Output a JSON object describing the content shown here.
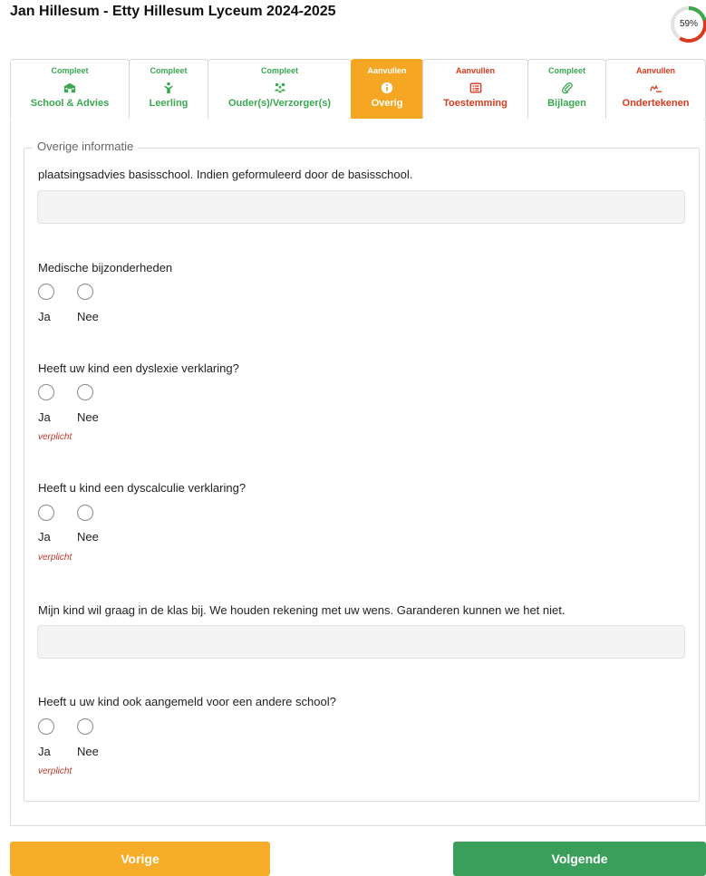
{
  "header": {
    "title": "Jan Hillesum - Etty Hillesum Lyceum 2024-2025",
    "progress_label": "59%",
    "progress_value": 59
  },
  "tabs": [
    {
      "status": "Compleet",
      "label": "School & Advies",
      "icon": "school-icon"
    },
    {
      "status": "Compleet",
      "label": "Leerling",
      "icon": "student-icon"
    },
    {
      "status": "Compleet",
      "label": "Ouder(s)/Verzorger(s)",
      "icon": "parents-icon"
    },
    {
      "status": "Aanvullen",
      "label": "Overig",
      "icon": "info-icon"
    },
    {
      "status": "Aanvullen",
      "label": "Toestemming",
      "icon": "list-icon"
    },
    {
      "status": "Compleet",
      "label": "Bijlagen",
      "icon": "paperclip-icon"
    },
    {
      "status": "Aanvullen",
      "label": "Ondertekenen",
      "icon": "signature-icon"
    }
  ],
  "form": {
    "legend": "Overige informatie",
    "advice_label": "plaatsingsadvies basisschool. Indien geformuleerd door de basisschool.",
    "advice_value": "",
    "q_medical": {
      "label": "Medische bijzonderheden",
      "yes": "Ja",
      "no": "Nee"
    },
    "q_dyslexia": {
      "label": "Heeft uw kind een dyslexie verklaring?",
      "yes": "Ja",
      "no": "Nee",
      "required": "verplicht"
    },
    "q_dyscalculia": {
      "label": "Heeft u kind een dyscalculie verklaring?",
      "yes": "Ja",
      "no": "Nee",
      "required": "verplicht"
    },
    "class_label": "Mijn kind wil graag in de klas bij. We houden rekening met uw wens. Garanderen kunnen we het niet.",
    "class_value": "",
    "q_other_school": {
      "label": "Heeft u uw kind ook aangemeld voor een andere school?",
      "yes": "Ja",
      "no": "Nee",
      "required": "verplicht"
    }
  },
  "nav": {
    "prev": "Vorige",
    "next": "Volgende"
  },
  "colors": {
    "complete": "#3aa84f",
    "todo": "#d9391f",
    "active": "#f5a623",
    "next": "#3a9f5a",
    "prev": "#f7ad29"
  }
}
